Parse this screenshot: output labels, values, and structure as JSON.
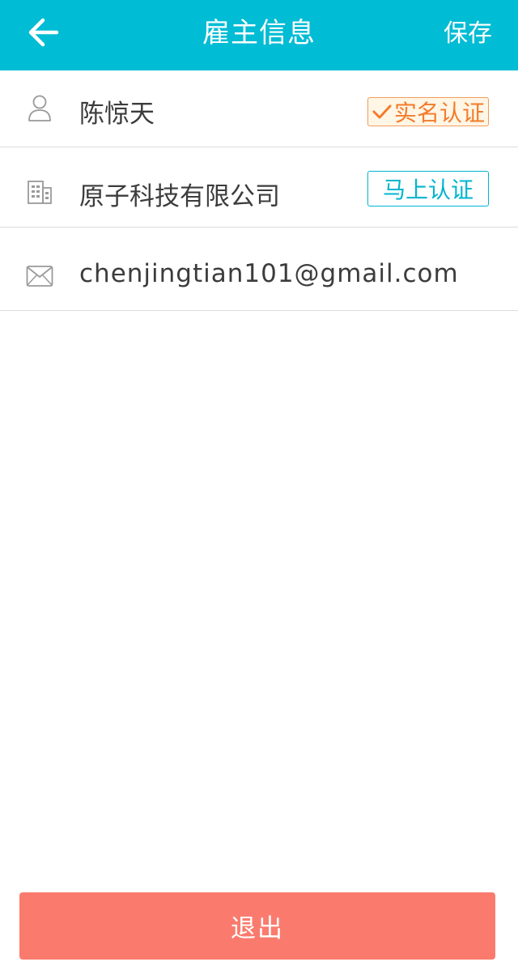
{
  "header": {
    "title": "雇主信息",
    "save_label": "保存",
    "back_icon": "arrow-left-icon"
  },
  "profile": {
    "name": "陈惊天",
    "name_icon": "user-icon",
    "name_badge": "实名认证",
    "company": "原子科技有限公司",
    "company_icon": "building-icon",
    "company_badge": "马上认证",
    "email": "chenjingtian101@gmail.com",
    "email_icon": "mail-icon"
  },
  "footer": {
    "logout_label": "退出"
  },
  "colors": {
    "header_bg": "#00BCD4",
    "verified": "#F37B2B",
    "verify_now": "#00B5CF",
    "logout_bg": "#FA7B6E"
  }
}
